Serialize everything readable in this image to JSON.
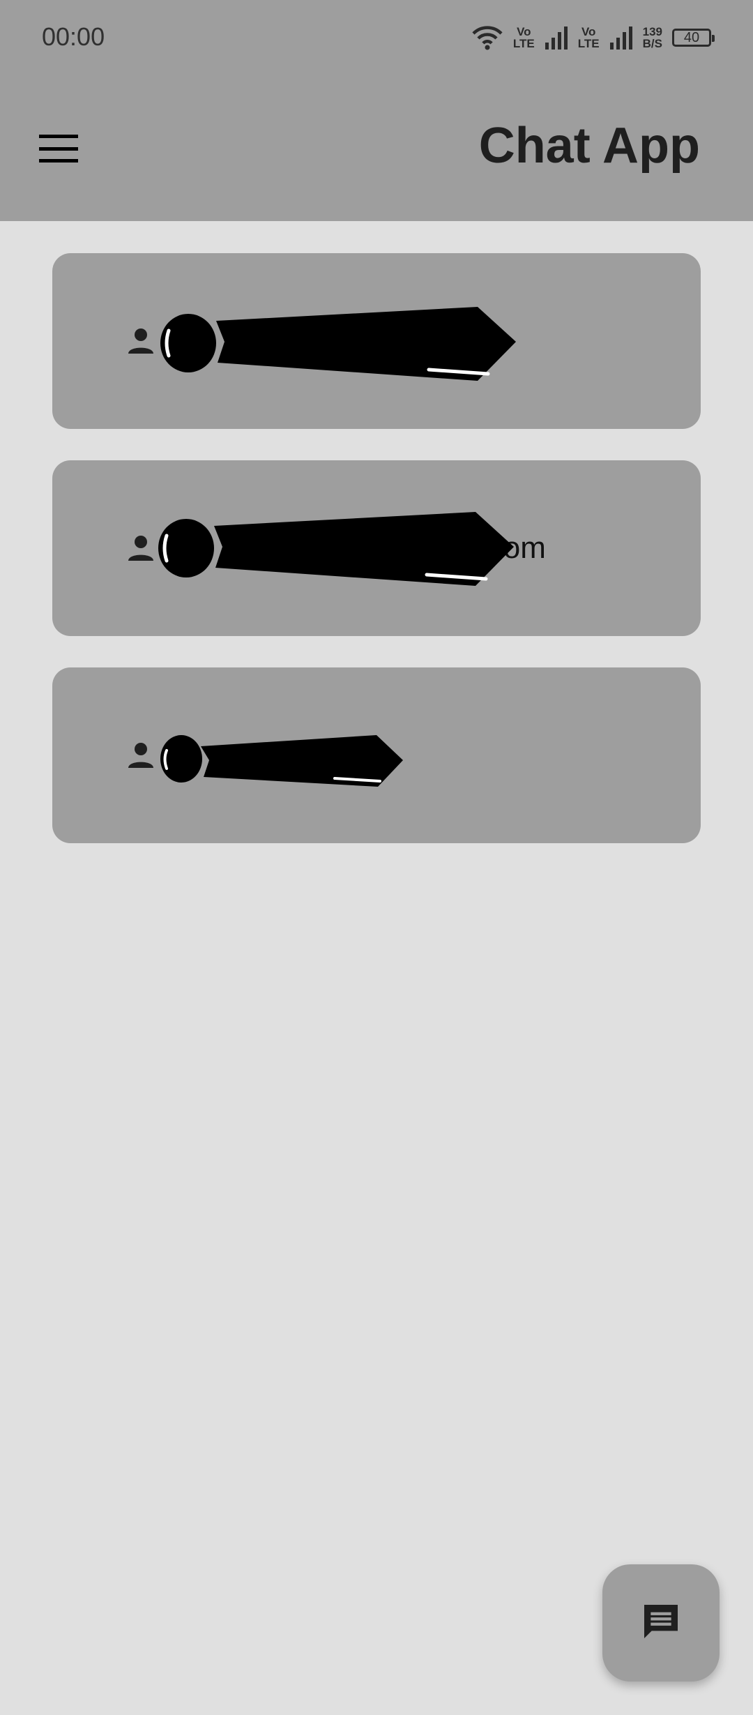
{
  "status_bar": {
    "time": "00:00",
    "lte1": [
      "Vo",
      "LTE"
    ],
    "lte2": [
      "Vo",
      "LTE"
    ],
    "speed": [
      "139",
      "B/S"
    ],
    "battery": "40",
    "icons": [
      "wifi-icon",
      "signal-icon",
      "signal-icon",
      "battery-icon"
    ]
  },
  "app_bar": {
    "title": "Chat App",
    "menu_icon": "menu-icon"
  },
  "users": [
    {
      "label": ""
    },
    {
      "label": "nail.com"
    },
    {
      "label": ""
    }
  ],
  "fab": {
    "icon": "chat-icon"
  },
  "colors": {
    "background": "#e0e0e0",
    "app_bar": "#9e9e9e",
    "card": "#9e9e9e",
    "redaction": "#000000"
  }
}
